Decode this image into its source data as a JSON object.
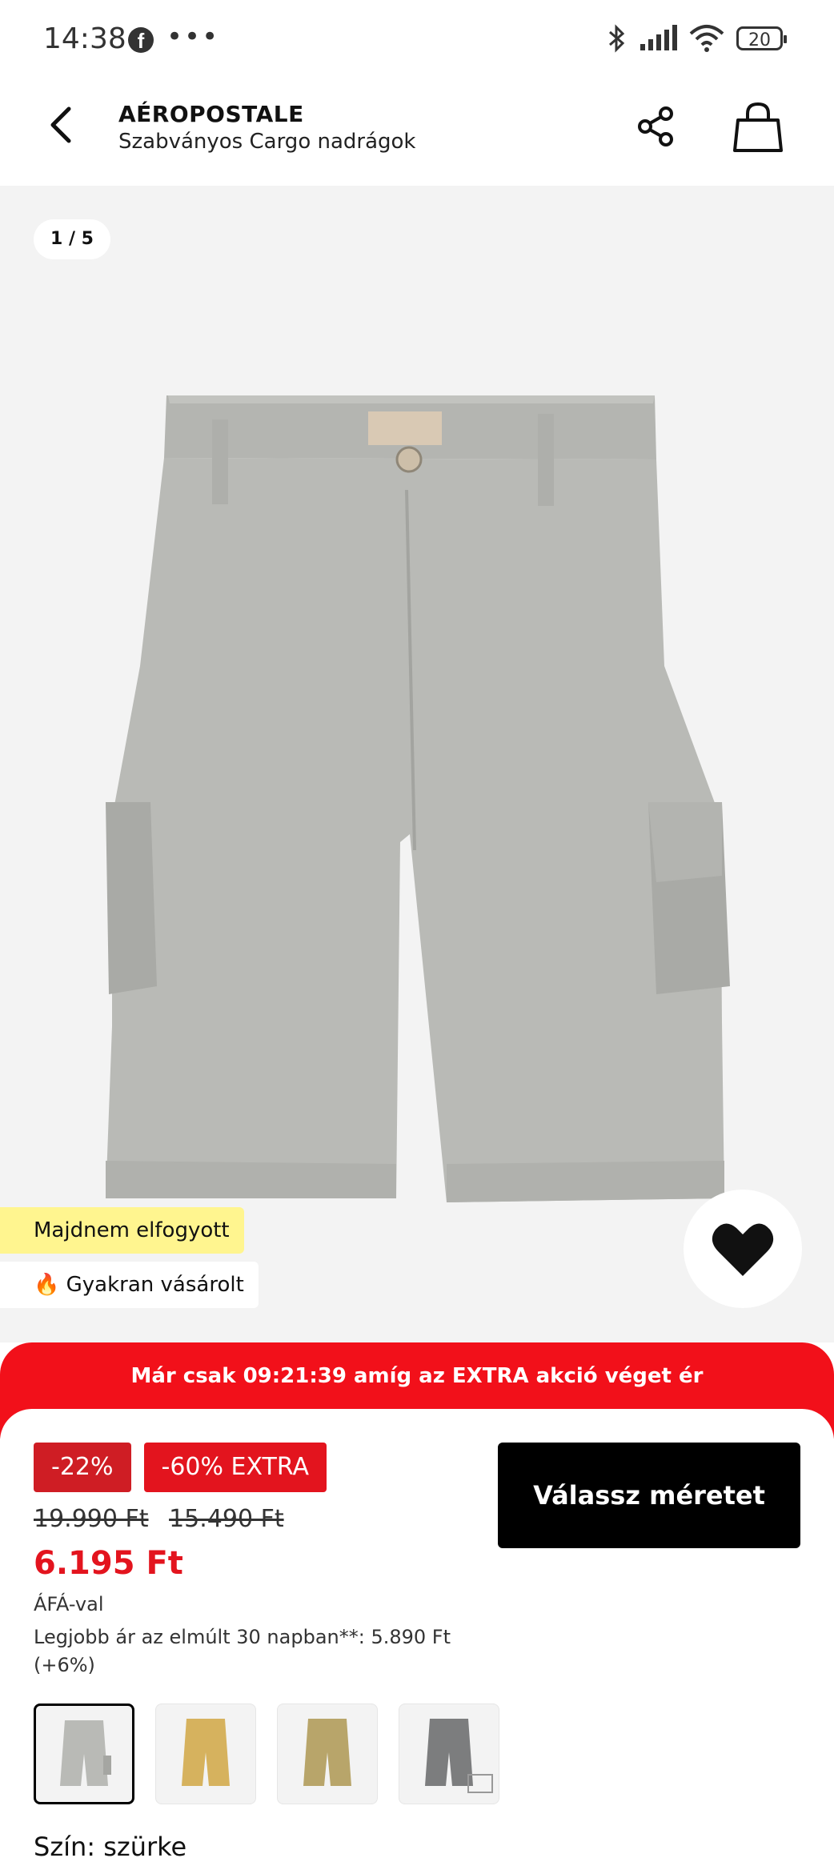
{
  "status_bar": {
    "time": "14:38",
    "notification_icon": "facebook-icon",
    "more": "•••",
    "battery": "20",
    "icons": [
      "bluetooth-icon",
      "signal-icon",
      "wifi-icon",
      "battery-icon"
    ]
  },
  "header": {
    "brand": "AÉROPOSTALE",
    "product_name": "Szabványos Cargo nadrágok"
  },
  "gallery": {
    "counter": "1 / 5",
    "image_alt": "grey cargo shorts",
    "badges": [
      "Majdnem elfogyott",
      "🔥 Gyakran vásárolt"
    ]
  },
  "promo": {
    "text": "Már csak 09:21:39 amíg az EXTRA akció véget ér"
  },
  "pricing": {
    "discount_tag": "-22%",
    "extra_tag": "-60% EXTRA",
    "original_price": "19.990 Ft",
    "previous_price": "15.490 Ft",
    "current_price": "6.195 Ft",
    "vat_note": "ÁFÁ-val",
    "best_price_note": "Legjobb ár az elmúlt 30 napban**: 5.890 Ft (+6%)"
  },
  "cta": {
    "label": "Válassz méretet"
  },
  "colors": {
    "thumbnails": [
      {
        "name": "szürke",
        "hex": "#b9bab6",
        "selected": true
      },
      {
        "name": "sárga",
        "hex": "#d6b25e",
        "selected": false
      },
      {
        "name": "khaki",
        "hex": "#b8a56a",
        "selected": false
      },
      {
        "name": "sötétszürke",
        "hex": "#7c7d7e",
        "selected": false
      }
    ],
    "label": "Szín: szürke"
  },
  "theme": {
    "accent_red": "#e3141e",
    "badge_yellow": "#fff58f"
  }
}
